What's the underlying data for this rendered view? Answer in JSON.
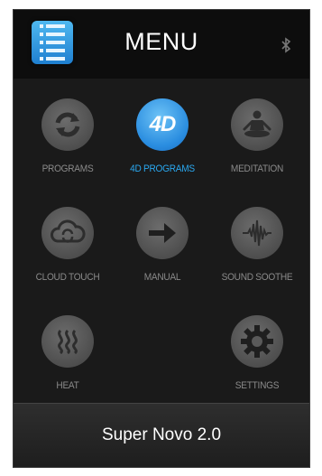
{
  "header": {
    "title": "MENU",
    "menu_icon": "menu-list-icon",
    "status_icon": "bluetooth-icon"
  },
  "programs": [
    {
      "label": "PROGRAMS",
      "icon": "refresh-icon",
      "active": false
    },
    {
      "label": "4D PROGRAMS",
      "icon": "4d-icon",
      "active": true,
      "icon_text": "4D"
    },
    {
      "label": "MEDITATION",
      "icon": "meditation-icon",
      "active": false
    },
    {
      "label": "CLOUD TOUCH",
      "icon": "cloud-touch-icon",
      "active": false
    },
    {
      "label": "MANUAL",
      "icon": "arrow-right-icon",
      "active": false
    },
    {
      "label": "SOUND SOOTHE",
      "icon": "sound-wave-icon",
      "active": false
    },
    {
      "label": "HEAT",
      "icon": "heat-icon",
      "active": false
    },
    {
      "label": "SETTINGS",
      "icon": "gear-icon",
      "active": false
    }
  ],
  "footer": {
    "device_name": "Super Novo 2.0"
  },
  "colors": {
    "accent": "#2aa8f0",
    "background": "#1a1a1a",
    "icon_bg": "#4e4e4e",
    "label": "#8a8a8a"
  }
}
